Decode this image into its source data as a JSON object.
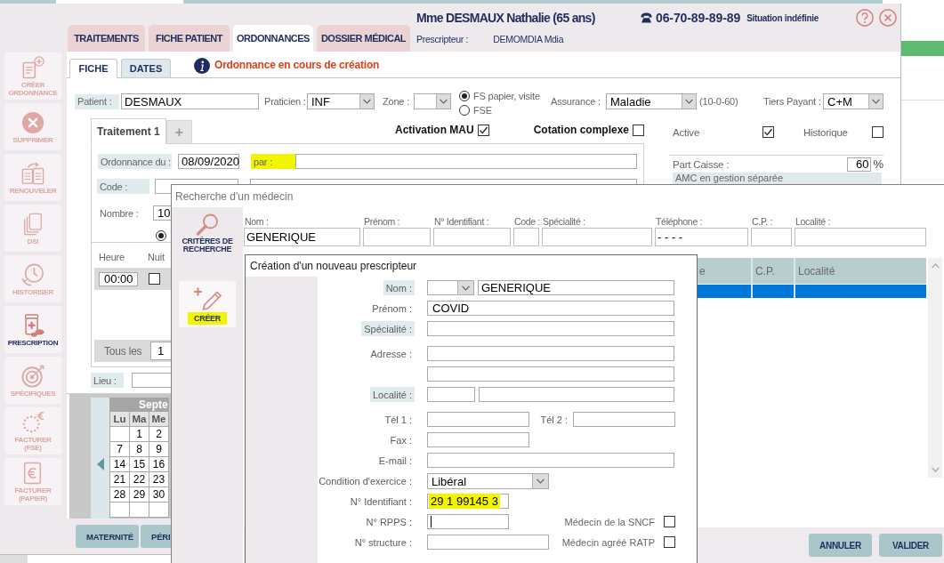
{
  "header": {
    "patient_title": "Mme DESMAUX Nathalie (65 ans)",
    "phone": "06-70-89-89-89",
    "situation": "Situation indéfinie",
    "prescriber_label": "Prescripteur :",
    "prescriber_value": "DEMOMDIA Mdia"
  },
  "main_tabs": [
    {
      "label": "TRAITEMENTS",
      "selected": false
    },
    {
      "label": "FICHE PATIENT",
      "selected": false
    },
    {
      "label": "ORDONNANCES",
      "selected": true
    },
    {
      "label": "DOSSIER MÉDICAL",
      "selected": false
    }
  ],
  "sidebar": {
    "items": [
      {
        "label": "CRÉER ORDONNANCE",
        "selected": false
      },
      {
        "label": "SUPPRIMER",
        "selected": false
      },
      {
        "label": "RENOUVELER",
        "selected": false
      },
      {
        "label": "DSI",
        "selected": false
      },
      {
        "label": "HISTORISER",
        "selected": false
      },
      {
        "label": "PRESCRIPTION",
        "selected": true
      },
      {
        "label": "SPÉCIFIQUES",
        "selected": false
      },
      {
        "label": "FACTURER (FSE)",
        "selected": false
      },
      {
        "label": "FACTURER (PAPIER)",
        "selected": false
      }
    ]
  },
  "sub_tabs": [
    {
      "label": "FICHE",
      "selected": true
    },
    {
      "label": "DATES",
      "selected": false
    }
  ],
  "status_message": "Ordonnance en cours de création",
  "patient_row": {
    "patient": {
      "label": "Patient :",
      "value": "DESMAUX"
    },
    "praticien": {
      "label": "Praticien :",
      "value": "INF"
    },
    "zone": {
      "label": "Zone :"
    },
    "billing": [
      {
        "label": "FS papier, visite",
        "selected": true
      },
      {
        "label": "FSE",
        "selected": false
      }
    ],
    "assurance": {
      "label": "Assurance :",
      "value": "Maladie",
      "rates": "(10-0-60)"
    },
    "tiers_payant": {
      "label": "Tiers Payant :",
      "value": "C+M"
    }
  },
  "treatment_tabs": [
    {
      "label": "Traitement 1",
      "selected": true
    },
    {
      "label": "+",
      "selected": false
    }
  ],
  "treatment_flags": [
    {
      "label": "Activation MAU",
      "checked": true
    },
    {
      "label": "Cotation complexe",
      "checked": false
    }
  ],
  "treatment": {
    "ordonnance_du": {
      "label": "Ordonnance du :",
      "value": "08/09/2020"
    },
    "par": {
      "label": "par :",
      "highlighted": true
    },
    "code": {
      "label": "Code :"
    },
    "nombre": {
      "label": "Nombre :",
      "value": "10"
    },
    "frequency_option": {
      "selected": true
    },
    "schedule": {
      "columns": [
        "Heure",
        "Nuit"
      ],
      "rows": [
        {
          "time": "00:00",
          "night": false
        }
      ]
    },
    "repeat": {
      "label": "Tous les",
      "value": "1"
    }
  },
  "lieu": {
    "label": "Lieu :"
  },
  "calendar": {
    "month": "Septe",
    "weekdays": [
      "Lu",
      "Ma",
      "Me"
    ],
    "weeks": [
      [
        "1",
        "2"
      ],
      [
        "7",
        "8",
        "9"
      ],
      [
        "14",
        "15",
        "16"
      ],
      [
        "21",
        "22",
        "23"
      ],
      [
        "28",
        "29",
        "30"
      ]
    ]
  },
  "bottom_buttons": [
    "MATERNITÉ",
    "PÉRI"
  ],
  "right_panel": {
    "flags": [
      {
        "label": "Active",
        "checked": true
      },
      {
        "label": "Historique",
        "checked": false
      }
    ],
    "part_caisse": {
      "label": "Part Caisse :",
      "value": "60",
      "unit": "%"
    },
    "amc_note": "AMC en gestion séparée"
  },
  "search_dialog": {
    "title": "Recherche d'un médecin",
    "actions": [
      {
        "kind": "section",
        "label": "CRITÈRES DE RECHERCHE",
        "highlighted": false
      },
      {
        "kind": "button",
        "label": "CRÉER",
        "highlighted": true
      }
    ],
    "criteria": [
      {
        "label": "Nom :",
        "value": "GENERIQUE"
      },
      {
        "label": "Prénom :"
      },
      {
        "label": "N° Identifiant :"
      },
      {
        "label": "Code :"
      },
      {
        "label": "Spécialité :"
      },
      {
        "label": "Téléphone :",
        "value": "- - - -"
      },
      {
        "label": "C.P. :"
      },
      {
        "label": "Localité :"
      }
    ],
    "results": {
      "columns": [
        "e",
        "C.P.",
        "Localité"
      ],
      "rows": [
        {
          "selected": true
        }
      ]
    },
    "buttons": [
      "ANNULER",
      "VALIDER"
    ]
  },
  "creation_dialog": {
    "title": "Création d'un nouveau prescripteur",
    "rows": [
      {
        "kind": "name",
        "label": "Nom :",
        "shaded": true,
        "value": "GENERIQUE"
      },
      {
        "kind": "text",
        "label": "Prénom :",
        "shaded": false,
        "value": "COVID"
      },
      {
        "kind": "text",
        "label": "Spécialité :",
        "shaded": true
      },
      {
        "kind": "address",
        "label": "Adresse :",
        "shaded": false
      },
      {
        "kind": "locality",
        "label": "Localité :",
        "shaded": true
      },
      {
        "kind": "phones",
        "label": "Tél 1 :",
        "shaded": false,
        "second_label": "Tél 2 :"
      },
      {
        "kind": "short",
        "label": "Fax :",
        "shaded": false
      },
      {
        "kind": "text",
        "label": "E-mail :",
        "shaded": false
      },
      {
        "kind": "select",
        "label": "Condition d'exercice :",
        "shaded": false,
        "value": "Libéral"
      },
      {
        "kind": "id",
        "label": "N° Identifiant :",
        "shaded": false,
        "value": "29 1 99145 3",
        "highlighted": true
      },
      {
        "kind": "id",
        "label": "N° RPPS :",
        "shaded": false,
        "focused": true,
        "option": {
          "label": "Médecin de la SNCF",
          "checked": false
        }
      },
      {
        "kind": "structure",
        "label": "N° structure :",
        "shaded": false,
        "option": {
          "label": "Médecin agréé RATP",
          "checked": false
        }
      }
    ]
  }
}
